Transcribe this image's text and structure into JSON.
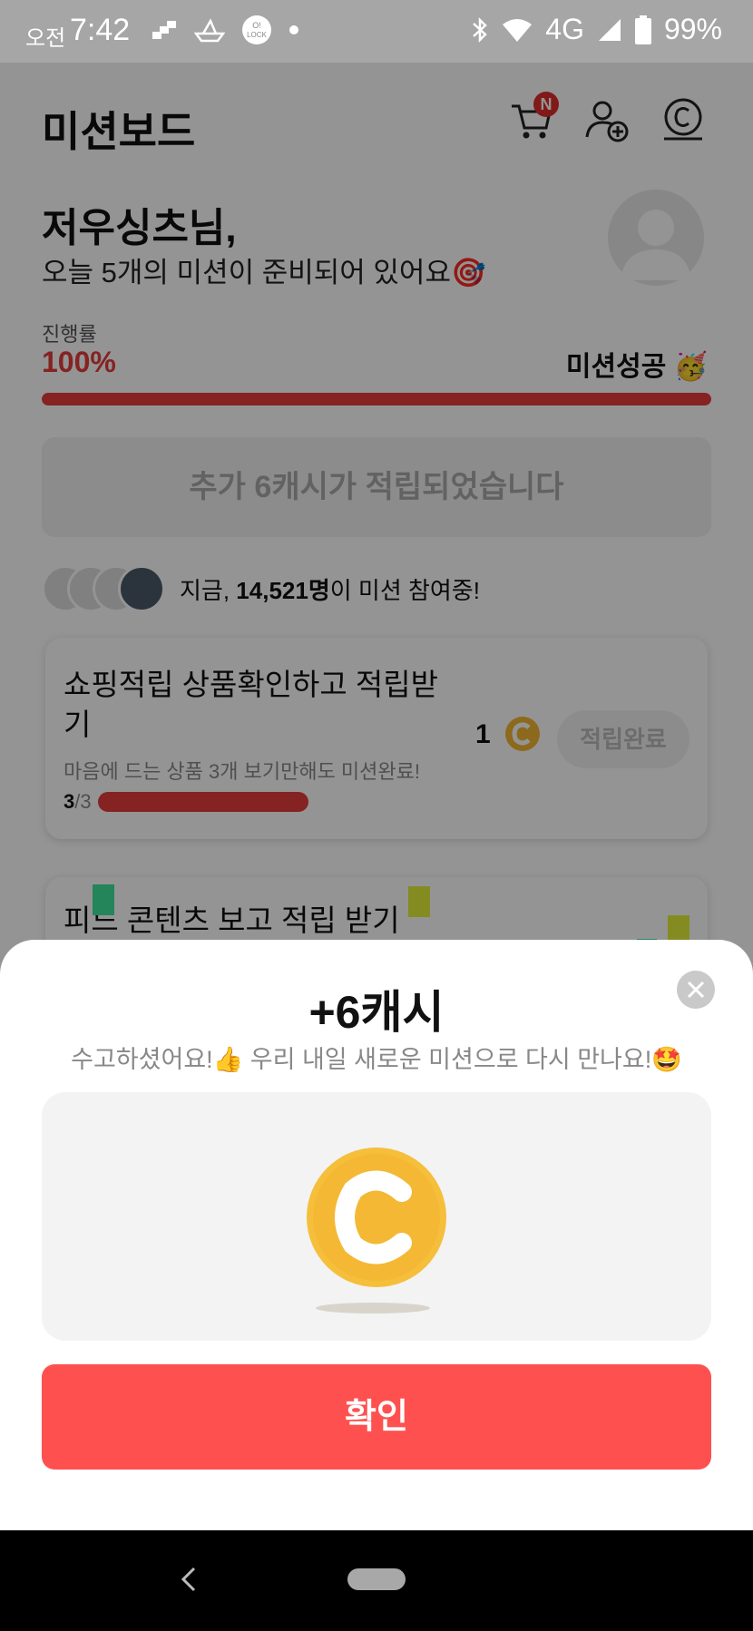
{
  "status_bar": {
    "ampm": "오전",
    "time": "7:42",
    "network": "4G",
    "battery": "99%",
    "icons": [
      "notification-icon",
      "boat-icon",
      "olock-icon",
      "dot-icon",
      "bluetooth-icon",
      "wifi-icon",
      "signal-icon",
      "battery-icon"
    ]
  },
  "header": {
    "title": "미션보드",
    "cart_badge": "N",
    "icons": [
      "cart-icon",
      "add-friend-icon",
      "cash-icon"
    ]
  },
  "greeting": {
    "name": "저우싱츠님,",
    "subtitle": "오늘 5개의 미션이 준비되어 있어요🎯"
  },
  "progress": {
    "label": "진행률",
    "value_text": "100%",
    "fraction": 1.0,
    "status": "미션성공 🥳",
    "color": "#e63b3b"
  },
  "banner": {
    "text": "추가 6캐시가 적립되었습니다"
  },
  "participants": {
    "prefix": "지금, ",
    "count": "14,521명",
    "suffix": "이 미션 참여중!"
  },
  "missions": [
    {
      "title": "쇼핑적립 상품확인하고 적립받기",
      "description": "마음에 드는 상품 3개 보기만해도 미션완료!",
      "done": "3",
      "total": "/3",
      "reward": "1",
      "button": "적립완료"
    },
    {
      "title": "피드 콘텐츠 보고 적립 받기"
    }
  ],
  "sheet": {
    "title": "+6캐시",
    "subtitle": "수고하셨어요!👍 우리 내일 새로운 미션으로 다시 만나요!🤩",
    "confirm": "확인",
    "coin_color": "#f5bf3b"
  },
  "colors": {
    "accent": "#ff5050",
    "progress": "#e63b3b"
  }
}
